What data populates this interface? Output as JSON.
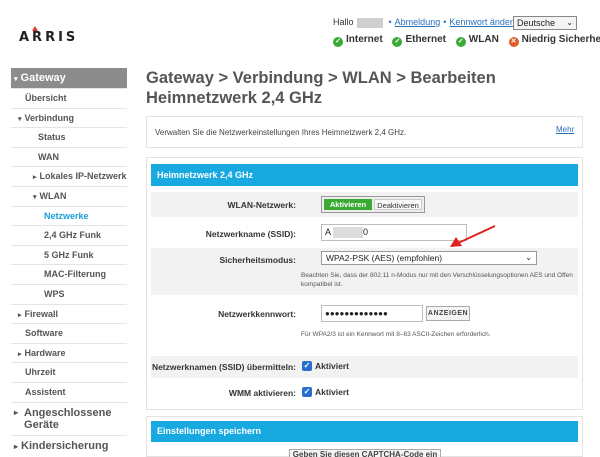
{
  "header": {
    "logo": "ARRIS",
    "greeting": "Hallo",
    "logout": "Abmeldung",
    "change_password": "Kennwort ändern",
    "language": "Deutsche",
    "status": [
      {
        "label": "Internet",
        "state": "ok"
      },
      {
        "label": "Ethernet",
        "state": "ok"
      },
      {
        "label": "WLAN",
        "state": "ok"
      },
      {
        "label": "Niedrig Sicherheit",
        "state": "warn"
      }
    ]
  },
  "sidebar": {
    "gateway": "Gateway",
    "uebersicht": "Übersicht",
    "verbindung": "Verbindung",
    "status": "Status",
    "wan": "WAN",
    "lokales": "Lokales IP-Netzwerk",
    "wlan": "WLAN",
    "netzwerke": "Netzwerke",
    "funk24": "2,4 GHz Funk",
    "funk5": "5 GHz Funk",
    "mac": "MAC-Filterung",
    "wps": "WPS",
    "firewall": "Firewall",
    "software": "Software",
    "hardware": "Hardware",
    "uhrzeit": "Uhrzeit",
    "assistent": "Assistent",
    "geraete": "Angeschlossene Geräte",
    "kinder": "Kindersicherung"
  },
  "main": {
    "title": "Gateway > Verbindung > WLAN > Bearbeiten Heimnetzwerk 2,4 GHz",
    "description": "Verwalten Sie die Netzwerkeinstellungen Ihres Heimnetzwerk 2,4 GHz.",
    "more": "Mehr"
  },
  "form": {
    "heading": "Heimnetzwerk 2,4 GHz",
    "wlan_label": "WLAN-Netzwerk:",
    "enable": "Aktivieren",
    "disable": "Deaktivieren",
    "ssid_label": "Netzwerkname (SSID):",
    "ssid_prefix": "A",
    "ssid_suffix": "0",
    "security_label": "Sicherheitsmodus:",
    "security_value": "WPA2-PSK (AES) (empfohlen)",
    "security_note": "Beachten Sie, dass der 802.11 n-Modus nur mit den Verschlüsselungsoptionen AES und Offen kompatibel ist.",
    "password_label": "Netzwerkkennwort:",
    "password_value": "●●●●●●●●●●●●●",
    "show_button": "ANZEIGEN",
    "password_note": "Für WPA2/3 ist ein Kennwort mit 8–63 ASCII-Zeichen erforderlich.",
    "broadcast_label": "Netzwerknamen (SSID) übermitteln:",
    "broadcast_value": "Aktiviert",
    "wmm_label": "WMM aktivieren:",
    "wmm_value": "Aktiviert"
  },
  "save": {
    "heading": "Einstellungen speichern",
    "captcha_button": "Geben Sie diesen CAPTCHA-Code ein"
  },
  "colors": {
    "accent": "#19a9e1",
    "enabled": "#3aaa35",
    "sidebar_active": "#8c8c8c",
    "link": "#2a6fbb",
    "arrow": "#e02020"
  }
}
